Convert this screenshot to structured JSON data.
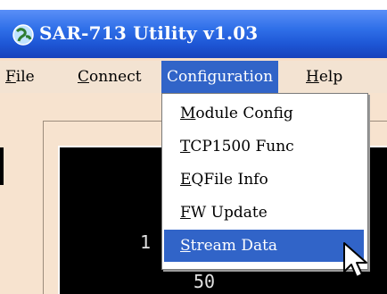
{
  "window": {
    "title": "SAR-713 Utility v1.03",
    "app_icon": "globe-app-icon"
  },
  "menubar": {
    "items": [
      {
        "mnemonic": "F",
        "rest": "ile"
      },
      {
        "mnemonic": "C",
        "rest": "onnect"
      },
      {
        "label": "Configuration"
      },
      {
        "mnemonic": "H",
        "rest": "elp"
      }
    ]
  },
  "configuration_menu": {
    "items": [
      {
        "mnemonic": "M",
        "rest": "odule Config"
      },
      {
        "mnemonic": "T",
        "rest": "CP1500 Func"
      },
      {
        "mnemonic": "E",
        "rest": "QFile Info"
      },
      {
        "mnemonic": "F",
        "rest": "W Update"
      },
      {
        "mnemonic": "S",
        "rest": "tream Data"
      }
    ]
  },
  "display": {
    "labels": [
      "1",
      "50"
    ]
  },
  "colors": {
    "title_bar": "#2f6fe8",
    "menu_highlight": "#3164c8",
    "window_bg": "#f7e3cf",
    "display_bg": "#000000"
  }
}
